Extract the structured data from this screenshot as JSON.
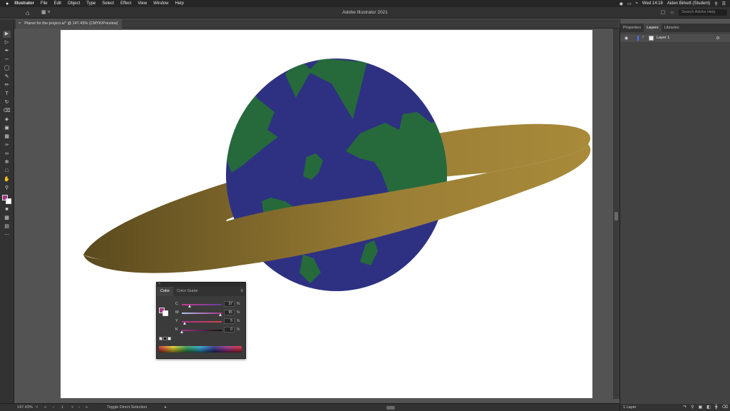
{
  "menubar": {
    "apple": "",
    "app": "Illustrator",
    "items": [
      "File",
      "Edit",
      "Object",
      "Type",
      "Select",
      "Effect",
      "View",
      "Window",
      "Help"
    ],
    "datetime": "Wed 14:18",
    "user": "Aiden Birkett (Student)"
  },
  "appbar": {
    "title": "Adobe Illustrator 2021",
    "search_placeholder": "Search Adobe Help"
  },
  "document": {
    "tab_title": "Planet for the project.ai* @ 147.43% (CMYK/Preview)",
    "close": "×"
  },
  "colors": {
    "planet": "#2e3182",
    "land": "#266a3b",
    "ring_light": "#a88a3a",
    "ring_dark": "#5a4a1e",
    "fill_color": "#a53289"
  },
  "statusbar": {
    "zoom": "147.43%",
    "artboard_num": "1",
    "tool_hint": "Toggle Direct Selection"
  },
  "layers_panel": {
    "tabs": [
      "Properties",
      "Layers",
      "Libraries"
    ],
    "active_tab": "Layers",
    "layer_name": "Layer 1",
    "layer_count": "1 Layer"
  },
  "color_panel": {
    "tabs": [
      "Color",
      "Color Guide"
    ],
    "active_tab": "Color",
    "channels": [
      {
        "label": "C",
        "value": "37",
        "pct": "%"
      },
      {
        "label": "M",
        "value": "95",
        "pct": "%"
      },
      {
        "label": "Y",
        "value": "5",
        "pct": "%"
      },
      {
        "label": "K",
        "value": "0",
        "pct": "%"
      }
    ]
  }
}
